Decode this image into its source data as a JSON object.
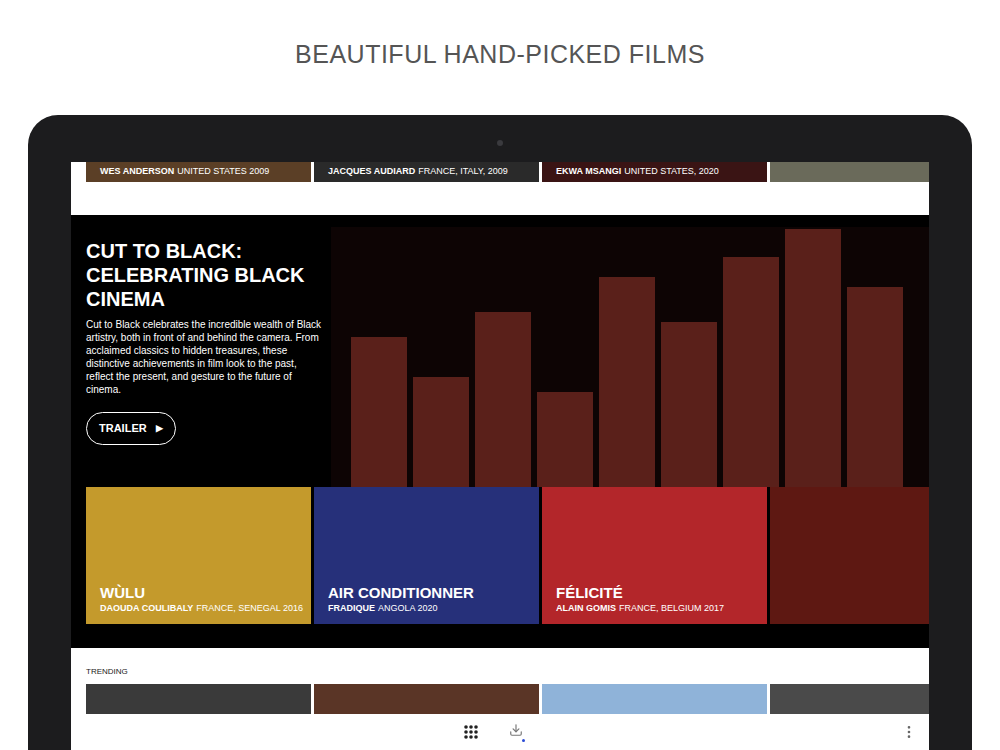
{
  "header": {
    "title": "BEAUTIFUL HAND-PICKED FILMS"
  },
  "top_row": [
    {
      "director": "WES ANDERSON",
      "details": "UNITED STATES 2009",
      "color": "#5b3f26"
    },
    {
      "director": "JACQUES AUDIARD",
      "details": "FRANCE, ITALY, 2009",
      "color": "#2a2a2a"
    },
    {
      "director": "EKWA MSANGI",
      "details": "UNITED STATES, 2020",
      "color": "#3a1414"
    },
    {
      "director": "",
      "details": "",
      "color": "#6a6a5a"
    }
  ],
  "hero": {
    "title": "CUT TO BLACK: CELEBRATING BLACK CINEMA",
    "description": "Cut to Black celebrates the incredible wealth of Black artistry, both in front of and behind the camera. From acclaimed classics to hidden treasures, these distinctive achievements in film look to the past, reflect the present, and gesture to the future of cinema.",
    "button": "TRAILER",
    "button_icon": "▶"
  },
  "films": [
    {
      "title": "WÙLU",
      "director": "DAOUDA COULIBALY",
      "details": "FRANCE, SENEGAL 2016",
      "color": "#c49a2c"
    },
    {
      "title": "AIR CONDITIONNER",
      "director": "FRADIQUE",
      "details": "ANGOLA 2020",
      "color": "#26307a"
    },
    {
      "title": "FÉLICITÉ",
      "director": "ALAIN GOMIS",
      "details": "FRANCE, BELGIUM 2017",
      "color": "#b3262a"
    },
    {
      "title": "",
      "director": "",
      "details": "",
      "color": "#5e1812"
    }
  ],
  "trending": {
    "label": "TRENDING",
    "thumbs": [
      {
        "color": "#3a3a3a"
      },
      {
        "color": "#5a3526"
      },
      {
        "color": "#8fb3d9"
      },
      {
        "color": "#4a4a4a"
      }
    ]
  }
}
